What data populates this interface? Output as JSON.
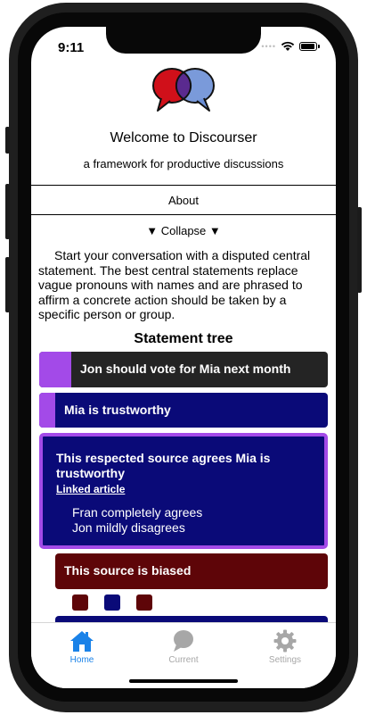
{
  "status_bar": {
    "time": "9:11"
  },
  "header": {
    "title": "Welcome to Discourser",
    "subtitle": "a framework for productive discussions"
  },
  "about": {
    "label": "About"
  },
  "collapse": {
    "label": "▼ Collapse ▼"
  },
  "intro_text": "Start your conversation with a disputed central statement. The best central statements replace vague pronouns with names and are phrased to affirm a concrete action should be taken by a specific person or group.",
  "tree": {
    "title": "Statement tree",
    "statements": [
      {
        "text": "Jon should vote for Mia next month",
        "color": "#242424"
      },
      {
        "text": "Mia is trustworthy",
        "color": "#0a0a78"
      },
      {
        "text": "This respected source agrees Mia is trustworthy",
        "link": "Linked article",
        "opinions": [
          "Fran completely agrees",
          "Jon mildly disagrees"
        ],
        "color": "#0a0a78"
      },
      {
        "text": "This source is biased",
        "color": "#5e0508"
      }
    ],
    "swatches": [
      "#5e0508",
      "#0a0a78",
      "#5e0508"
    ]
  },
  "tabs": [
    {
      "label": "Home",
      "icon": "home-icon",
      "active": true
    },
    {
      "label": "Current",
      "icon": "chat-bubble-icon",
      "active": false
    },
    {
      "label": "Settings",
      "icon": "gear-icon",
      "active": false
    }
  ],
  "colors": {
    "accent": "#a34ae8",
    "tab_active": "#1a82e8",
    "tab_inactive": "#a7a7a7"
  }
}
